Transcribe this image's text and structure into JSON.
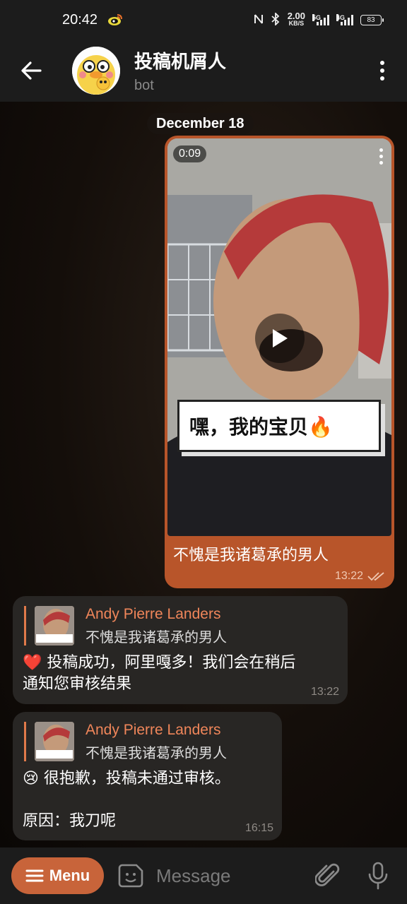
{
  "status_bar": {
    "time": "20:42",
    "net_speed_value": "2.00",
    "net_speed_unit": "KB/S",
    "signal1_label": "5G",
    "signal2_label": "4G",
    "battery": "83"
  },
  "header": {
    "title": "投稿机屑人",
    "subtitle": "bot"
  },
  "chat": {
    "date": "December 18",
    "outgoing": {
      "duration": "0:09",
      "sticker_text": "嘿，我的宝贝🔥",
      "caption": "不愧是我诸葛承的男人",
      "time": "13:22"
    },
    "incoming": [
      {
        "reply_name": "Andy Pierre Landers",
        "reply_text": "不愧是我诸葛承的男人",
        "text": "❤️ 投稿成功，阿里嘎多！我们会在稍后\n通知您审核结果",
        "time": "13:22"
      },
      {
        "reply_name": "Andy Pierre Landers",
        "reply_text": "不愧是我诸葛承的男人",
        "text": "😢 很抱歉，投稿未通过审核。\n\n原因：我刀呢",
        "time": "16:15"
      }
    ]
  },
  "input_bar": {
    "menu_label": "Menu",
    "placeholder": "Message"
  },
  "colors": {
    "accent": "#c8643a",
    "outgoing_bubble": "#b8552a",
    "incoming_bubble": "#282624",
    "reply_name": "#f0865a"
  }
}
